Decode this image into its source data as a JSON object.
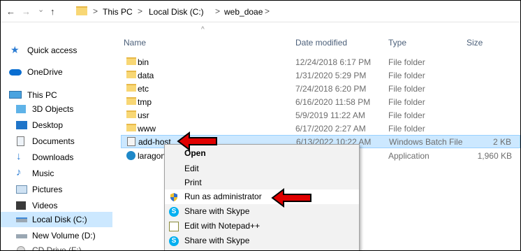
{
  "address": {
    "parts": [
      "This PC",
      "Local Disk (C:)",
      "web_doae"
    ],
    "separator": ">"
  },
  "nav": {
    "back": "←",
    "forward": "→",
    "dropdown": "⌄",
    "up": "↑"
  },
  "columns": {
    "name": "Name",
    "date": "Date modified",
    "type": "Type",
    "size": "Size"
  },
  "sidebar": {
    "items": [
      {
        "label": "Quick access"
      },
      {
        "label": "OneDrive"
      },
      {
        "label": "This PC"
      },
      {
        "label": "3D Objects"
      },
      {
        "label": "Desktop"
      },
      {
        "label": "Documents"
      },
      {
        "label": "Downloads"
      },
      {
        "label": "Music"
      },
      {
        "label": "Pictures"
      },
      {
        "label": "Videos"
      },
      {
        "label": "Local Disk (C:)"
      },
      {
        "label": "New Volume (D:)"
      },
      {
        "label": "CD Drive (F:)"
      }
    ]
  },
  "files": [
    {
      "name": "bin",
      "date": "12/24/2018 6:17 PM",
      "type": "File folder",
      "size": ""
    },
    {
      "name": "data",
      "date": "1/31/2020 5:29 PM",
      "type": "File folder",
      "size": ""
    },
    {
      "name": "etc",
      "date": "7/24/2018 6:20 PM",
      "type": "File folder",
      "size": ""
    },
    {
      "name": "tmp",
      "date": "6/16/2020 11:58 PM",
      "type": "File folder",
      "size": ""
    },
    {
      "name": "usr",
      "date": "5/9/2019 11:22 AM",
      "type": "File folder",
      "size": ""
    },
    {
      "name": "www",
      "date": "6/17/2020 2:27 AM",
      "type": "File folder",
      "size": ""
    },
    {
      "name": "add-host",
      "date": "6/13/2022 10:22 AM",
      "type": "Windows Batch File",
      "size": "2 KB"
    },
    {
      "name": "laragon",
      "date": "",
      "type": "Application",
      "size": "1,960 KB"
    }
  ],
  "context_menu": {
    "items": [
      {
        "label": "Open"
      },
      {
        "label": "Edit"
      },
      {
        "label": "Print"
      },
      {
        "label": "Run as administrator"
      },
      {
        "label": "Share with Skype"
      },
      {
        "label": "Edit with Notepad++"
      },
      {
        "label": "Share with Skype"
      }
    ]
  },
  "colors": {
    "selection": "#cce8ff",
    "arrow": "#e00000",
    "folder": "#f8d775"
  }
}
